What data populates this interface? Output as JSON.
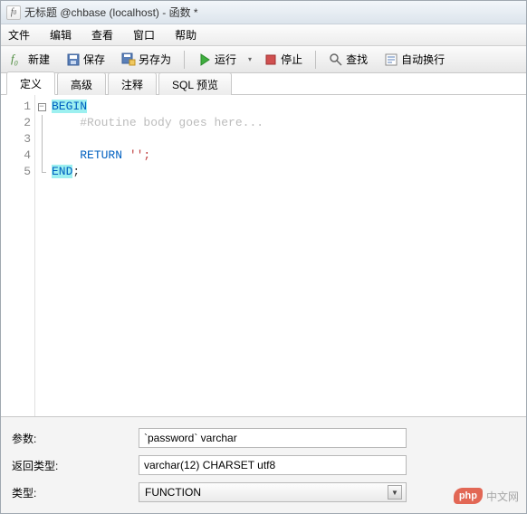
{
  "title": "无标题 @chbase (localhost) - 函数 *",
  "menu": {
    "file": "文件",
    "edit": "编辑",
    "view": "查看",
    "window": "窗口",
    "help": "帮助"
  },
  "toolbar": {
    "new": "新建",
    "save": "保存",
    "saveas": "另存为",
    "run": "运行",
    "stop": "停止",
    "find": "查找",
    "wrap": "自动换行"
  },
  "tabs": {
    "t0": "定义",
    "t1": "高级",
    "t2": "注释",
    "t3": "SQL 预览"
  },
  "code": {
    "l1": "BEGIN",
    "l2_indent": "    ",
    "l2": "#Routine body goes here...",
    "l3": "",
    "l4_indent": "    ",
    "l4a": "RETURN",
    "l4b": " '';",
    "l5": "END",
    "l5b": ";"
  },
  "lines": {
    "n1": "1",
    "n2": "2",
    "n3": "3",
    "n4": "4",
    "n5": "5"
  },
  "bottom": {
    "params_label": "参数:",
    "params_value": "`password` varchar",
    "returntype_label": "返回类型:",
    "returntype_value": "varchar(12) CHARSET utf8",
    "type_label": "类型:",
    "type_value": "FUNCTION"
  },
  "watermark": {
    "badge": "php",
    "text": "中文网"
  }
}
